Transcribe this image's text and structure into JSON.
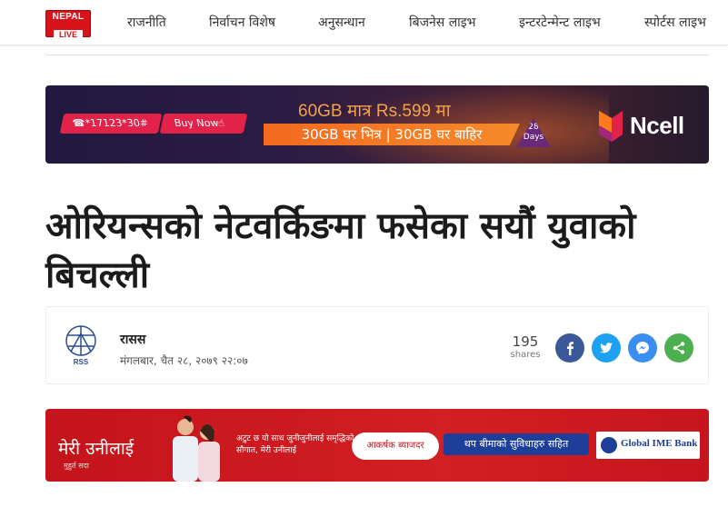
{
  "header": {
    "logo": {
      "top": "NEPAL",
      "bottom": "LIVE"
    },
    "nav": [
      {
        "label": "राजनीति"
      },
      {
        "label": "निर्वाचन विशेष"
      },
      {
        "label": "अनुसन्धान"
      },
      {
        "label": "बिजनेस लाइभ"
      },
      {
        "label": "इन्टरटेन्मेन्ट लाइभ"
      },
      {
        "label": "स्पोर्टस लाइभ"
      }
    ]
  },
  "ad_top": {
    "ussd": "*17123*30#",
    "buy_now": "Buy Now",
    "headline": "60GB मात्र Rs.599 मा",
    "offer": "30GB घर भित्र | 30GB घर बाहिर",
    "days_number": "28",
    "days_label": "Days",
    "brand": "Ncell"
  },
  "article": {
    "title": "ओरियन्सको नेटवर्किङमा फसेका सयौं युवाको बिचल्ली",
    "author": "रासस",
    "date": "मंगलबार, चैत २८, २०७९  २२:०७",
    "avatar_text": "RSS"
  },
  "share": {
    "count": "195",
    "label": "shares",
    "buttons": [
      {
        "icon": "facebook-icon",
        "color": "#3b5998"
      },
      {
        "icon": "twitter-icon",
        "color": "#1da1f2"
      },
      {
        "icon": "messenger-icon",
        "color": "#3a8ef0"
      },
      {
        "icon": "share-icon",
        "color": "#4caf50"
      }
    ]
  },
  "ad_bottom": {
    "title": "मेरी उनीलाई",
    "subtitle": "मुहुर्त सदा",
    "copy": "अटुट छ यो साथ जुनीजुनीलाई समृद्धिको सौगात, मेरी उनीलाई",
    "cloud": "आकर्षक ब्याजदर",
    "pill": "थप बीमाको सुविधाहरु सहित",
    "bank": "Global IME Bank"
  }
}
